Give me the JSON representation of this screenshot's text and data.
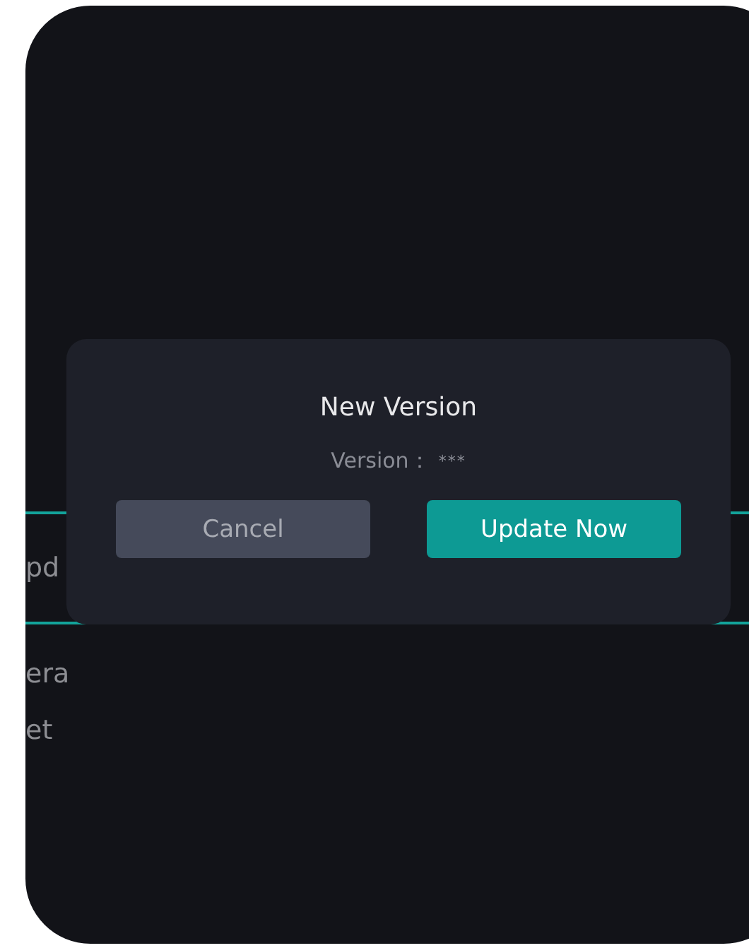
{
  "settings_list": {
    "items": [
      {
        "label": "pd",
        "selected": true
      },
      {
        "label": "era",
        "selected": false
      },
      {
        "label": "et",
        "selected": false
      }
    ]
  },
  "dialog": {
    "title": "New Version",
    "version_label": "Version：",
    "version_value": "***",
    "buttons": [
      {
        "label": "Cancel",
        "kind": "secondary"
      },
      {
        "label": "Update Now",
        "kind": "primary"
      }
    ]
  }
}
